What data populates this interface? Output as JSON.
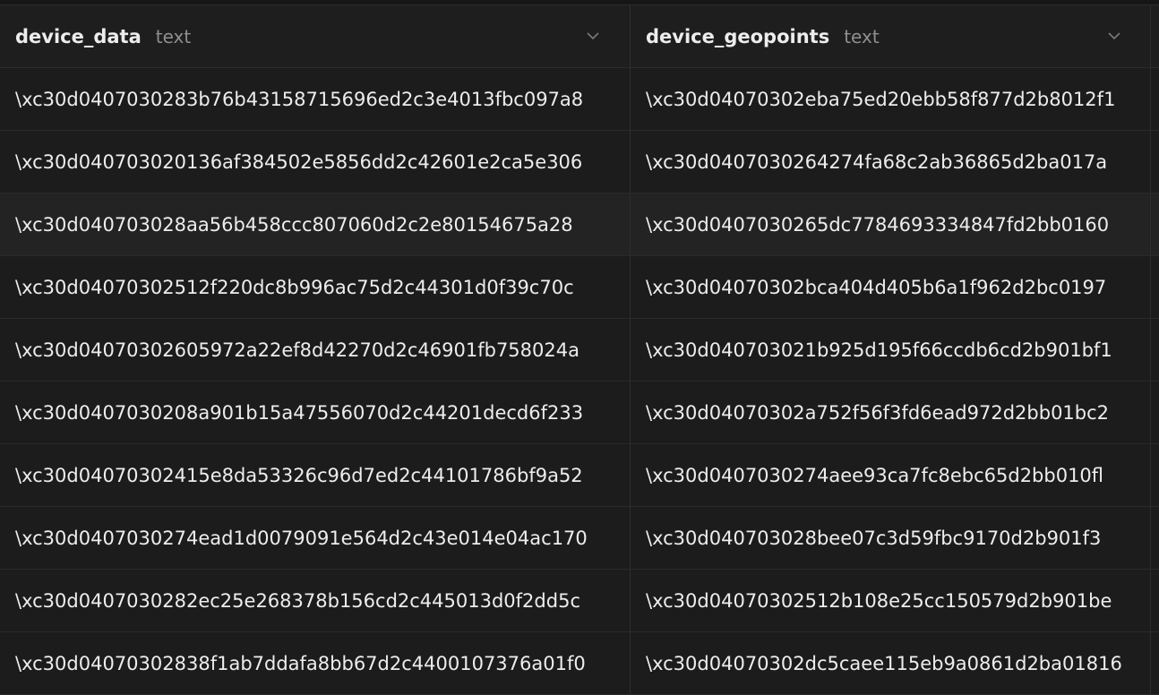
{
  "columns": [
    {
      "name": "device_data",
      "type": "text"
    },
    {
      "name": "device_geopoints",
      "type": "text"
    }
  ],
  "rows": [
    {
      "device_data": "\\xc30d0407030283b76b43158715696ed2c3e4013fbc097a8",
      "device_geopoints": "\\xc30d04070302eba75ed20ebb58f877d2b8012f1"
    },
    {
      "device_data": "\\xc30d040703020136af384502e5856dd2c42601e2ca5e306",
      "device_geopoints": "\\xc30d0407030264274fa68c2ab36865d2ba017a"
    },
    {
      "device_data": "\\xc30d040703028aa56b458ccc807060d2c2e80154675a28",
      "device_geopoints": "\\xc30d0407030265dc7784693334847fd2bb0160"
    },
    {
      "device_data": "\\xc30d04070302512f220dc8b996ac75d2c44301d0f39c70c",
      "device_geopoints": "\\xc30d04070302bca404d405b6a1f962d2bc0197"
    },
    {
      "device_data": "\\xc30d04070302605972a22ef8d42270d2c46901fb758024a",
      "device_geopoints": "\\xc30d040703021b925d195f66ccdb6cd2b901bf1"
    },
    {
      "device_data": "\\xc30d0407030208a901b15a47556070d2c44201decd6f233",
      "device_geopoints": "\\xc30d04070302a752f56f3fd6ead972d2bb01bc2"
    },
    {
      "device_data": "\\xc30d04070302415e8da53326c96d7ed2c44101786bf9a52",
      "device_geopoints": "\\xc30d0407030274aee93ca7fc8ebc65d2bb010fl"
    },
    {
      "device_data": "\\xc30d0407030274ead1d0079091e564d2c43e014e04ac170",
      "device_geopoints": "\\xc30d040703028bee07c3d59fbc9170d2b901f3"
    },
    {
      "device_data": "\\xc30d0407030282ec25e268378b156cd2c445013d0f2dd5c",
      "device_geopoints": "\\xc30d04070302512b108e25cc150579d2b901be"
    },
    {
      "device_data": "\\xc30d04070302838f1ab7ddafa8bb67d2c4400107376a01f0",
      "device_geopoints": "\\xc30d04070302dc5caee115eb9a0861d2ba01816"
    }
  ],
  "icons": {
    "sort_toggle": "chevron-down-icon"
  },
  "colors": {
    "background": "#1c1c1c",
    "header": "#1e1e1e",
    "selected_row": "#232323",
    "text": "#ededed",
    "muted_text": "#8f8f8f"
  },
  "selected_row_index": 2
}
